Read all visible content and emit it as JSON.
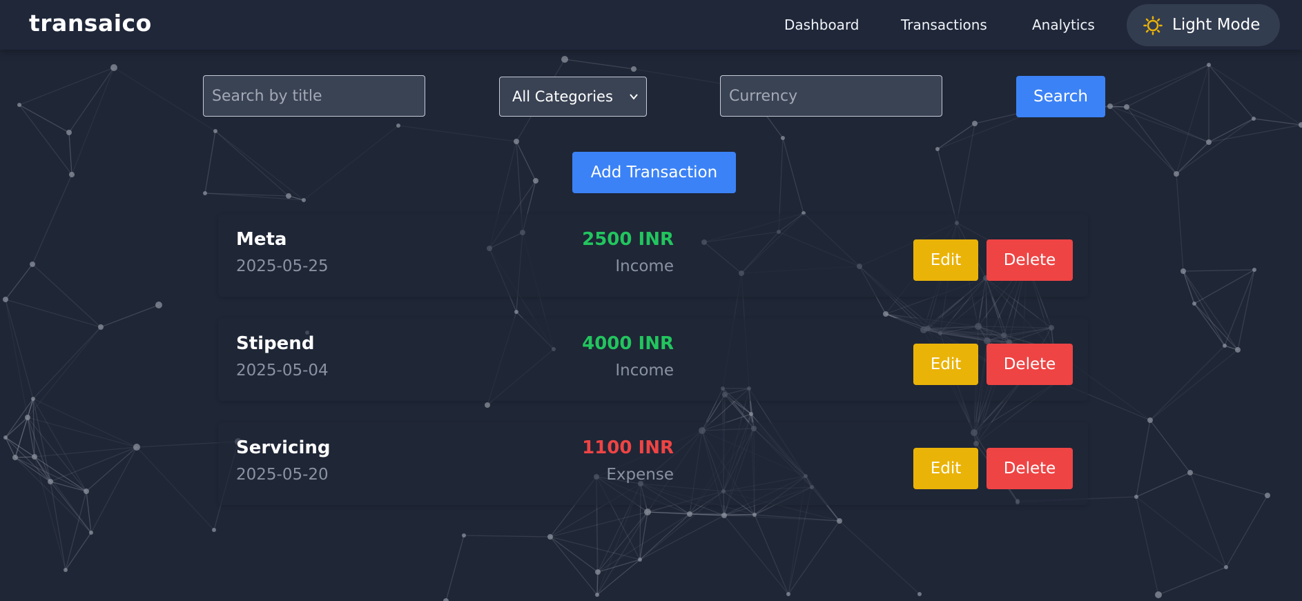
{
  "brand": "transaico",
  "nav": {
    "links": [
      "Dashboard",
      "Transactions",
      "Analytics"
    ],
    "mode_toggle_label": "Light Mode",
    "mode_icon": "sun-icon"
  },
  "filters": {
    "search_placeholder": "Search by title",
    "category_selected": "All Categories",
    "currency_placeholder": "Currency",
    "search_button_label": "Search"
  },
  "add_transaction_label": "Add Transaction",
  "transactions": [
    {
      "title": "Meta",
      "date": "2025-05-25",
      "amount": "2500 INR",
      "type": "Income",
      "edit_label": "Edit",
      "delete_label": "Delete"
    },
    {
      "title": "Stipend",
      "date": "2025-05-04",
      "amount": "4000 INR",
      "type": "Income",
      "edit_label": "Edit",
      "delete_label": "Delete"
    },
    {
      "title": "Servicing",
      "date": "2025-05-20",
      "amount": "1100 INR",
      "type": "Expense",
      "edit_label": "Edit",
      "delete_label": "Delete"
    }
  ],
  "colors": {
    "background": "#1f2636",
    "primary": "#3b82f6",
    "edit": "#eab308",
    "delete": "#ef4444",
    "income": "#22c55e",
    "expense": "#ef4444",
    "sun": "#eab308"
  }
}
